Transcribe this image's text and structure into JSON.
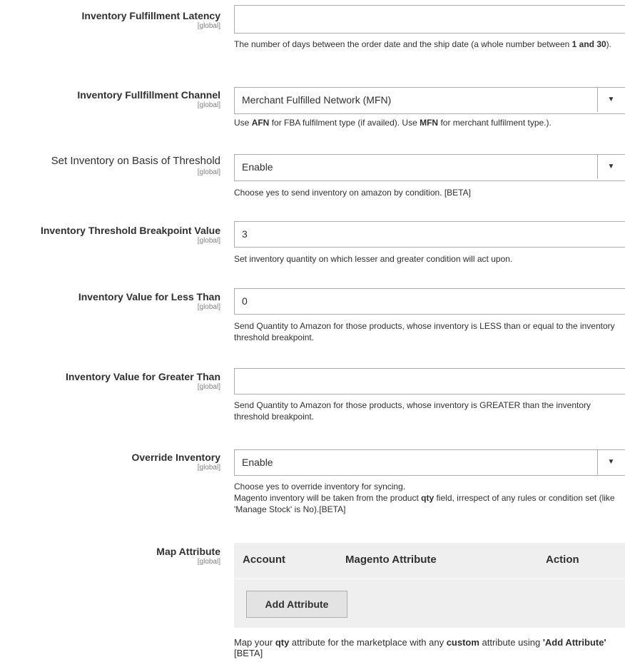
{
  "fields": [
    {
      "label": "Inventory Fulfillment Latency",
      "scope": "[global]",
      "type": "input",
      "value": "",
      "note_parts": [
        "The number of days between the order date and the ship date (a whole number between ",
        "1 and 30",
        ")."
      ]
    },
    {
      "label": "Inventory Fullfillment Channel",
      "scope": "[global]",
      "type": "select",
      "value": "Merchant Fulfilled Network (MFN)",
      "note_parts": [
        "Use ",
        "AFN",
        " for FBA fulfilment type (if availed). Use ",
        "MFN",
        " for merchant fulfilment type.)."
      ]
    },
    {
      "label": "Set Inventory on Basis of Threshold",
      "scope": "[global]",
      "type": "select",
      "value": "Enable",
      "note": "Choose yes to send inventory on amazon by condition. [BETA]"
    },
    {
      "label": "Inventory Threshold Breakpoint Value",
      "scope": "[global]",
      "type": "input",
      "value": "3",
      "note": "Set inventory quantity on which lesser and greater condition will act upon."
    },
    {
      "label": "Inventory Value for Less Than",
      "scope": "[global]",
      "type": "input",
      "value": "0",
      "note": "Send Quantity to Amazon for those products, whose inventory is LESS than or equal to the inventory threshold breakpoint."
    },
    {
      "label": "Inventory Value for Greater Than",
      "scope": "[global]",
      "type": "input",
      "value": "",
      "note": "Send Quantity to Amazon for those products, whose inventory is GREATER than the inventory threshold breakpoint."
    },
    {
      "label": "Override Inventory",
      "scope": "[global]",
      "type": "select",
      "value": "Enable",
      "note_line1": "Choose yes to override inventory for syncing.",
      "note_parts": [
        "Magento inventory will be taken from the product ",
        "qty",
        " field, irrespect of any rules or condition set (like 'Manage Stock' is No).[BETA]"
      ]
    }
  ],
  "map_attribute": {
    "label": "Map Attribute",
    "scope": "[global]",
    "columns": [
      "Account",
      "Magento Attribute",
      "Action"
    ],
    "add_button": "Add Attribute",
    "note_parts": [
      "Map your ",
      "qty",
      " attribute for the marketplace with any ",
      "custom",
      " attribute using ",
      "'Add Attribute'",
      " [BETA]"
    ]
  }
}
